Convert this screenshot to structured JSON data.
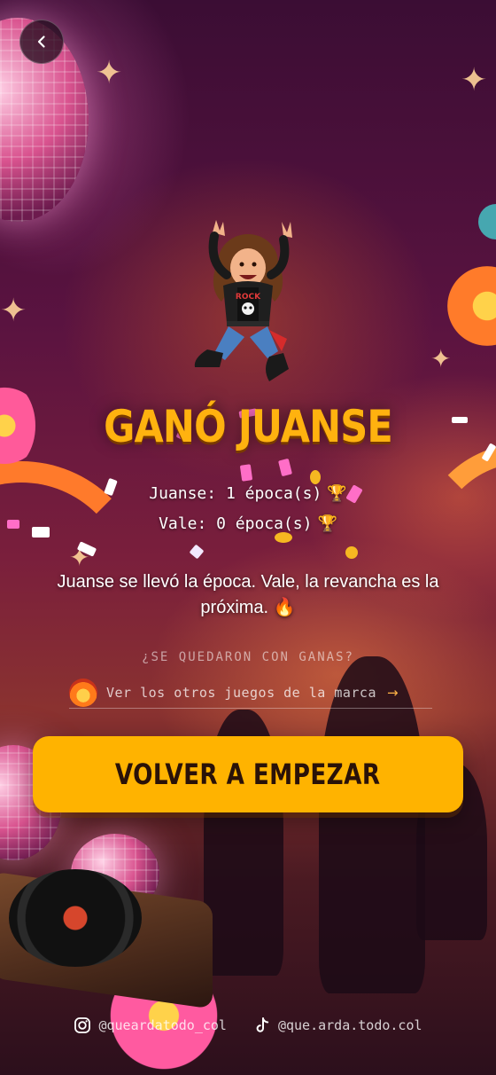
{
  "nav": {
    "back_icon": "chevron-left-icon"
  },
  "result": {
    "title": "GANÓ JUANSE",
    "scores": [
      {
        "text": "Juanse: 1 época(s)",
        "icon": "🏆"
      },
      {
        "text": "Vale: 0 época(s)",
        "icon": "🏆"
      }
    ],
    "message": "Juanse se llevó la época. Vale, la revancha es la próxima. 🔥"
  },
  "more_games": {
    "caption": "¿SE QUEDARON CON GANAS?",
    "link_label": "Ver los otros juegos de la marca",
    "arrow": "→"
  },
  "actions": {
    "restart_label": "VOLVER A EMPEZAR"
  },
  "socials": [
    {
      "icon": "instagram-icon",
      "handle": "@queardatodo_col"
    },
    {
      "icon": "tiktok-icon",
      "handle": "@que.arda.todo.col"
    }
  ],
  "colors": {
    "accent": "#ffb300",
    "title": "#ffb20f",
    "background": "#5a1340"
  }
}
